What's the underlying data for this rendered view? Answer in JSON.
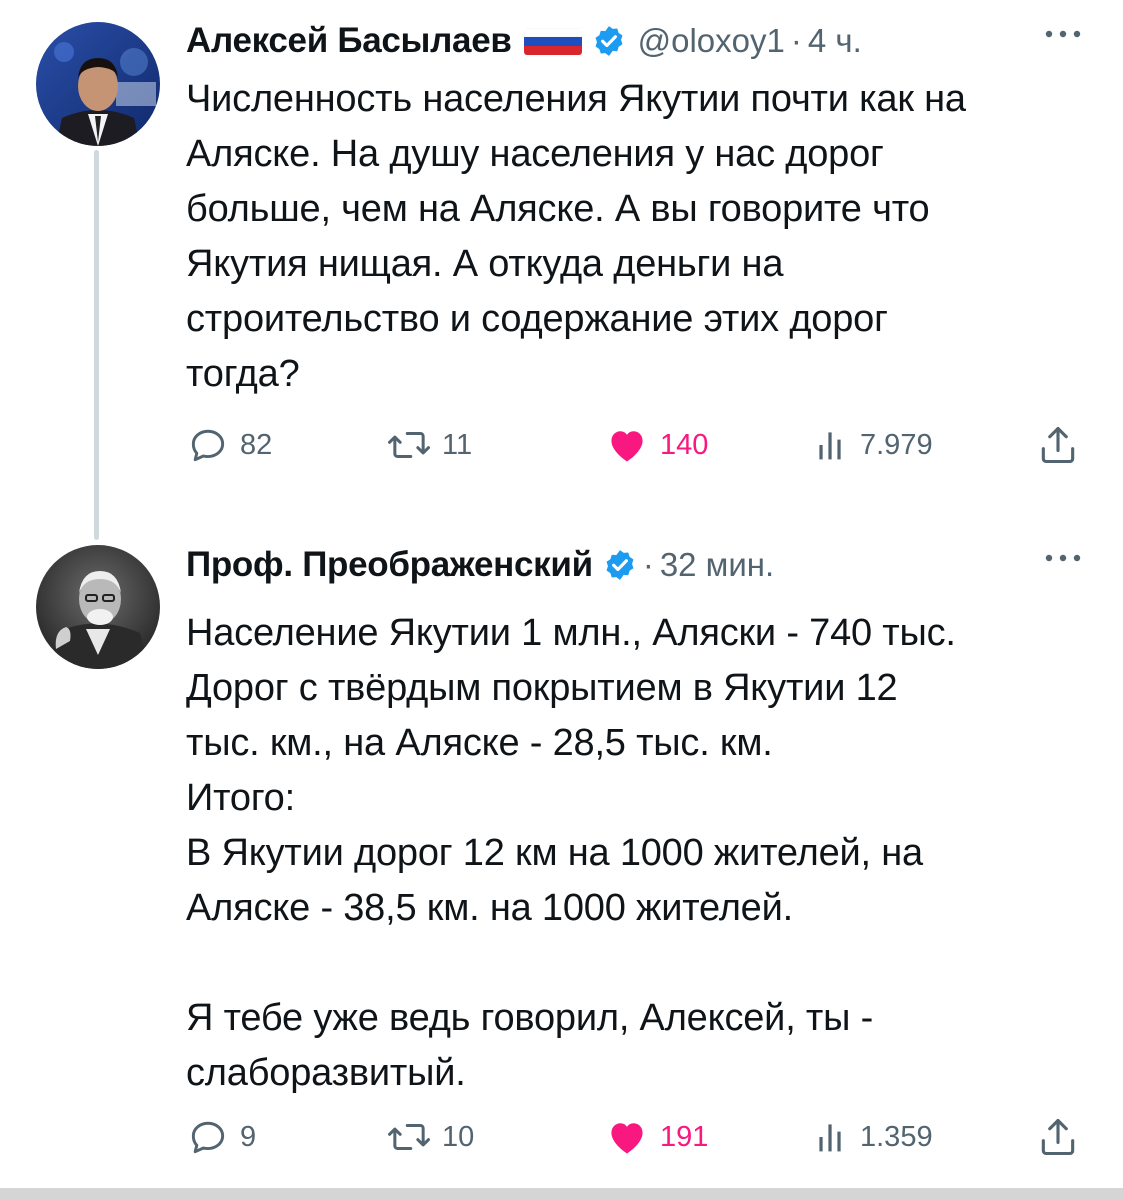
{
  "tweets": [
    {
      "author": {
        "name": "Алексей Басылаев",
        "flag": "russian-flag",
        "verified": true,
        "handle": "@oloxoy1",
        "time": "4 ч."
      },
      "text": "Численность населения Якутии почти как на\nАляске. На душу населения у нас дорог\nбольше, чем на Аляске. А вы говорите что\nЯкутия нищая. А откуда деньги на\nстроительство и содержание этих дорог\nтогда?",
      "stats": {
        "replies": "82",
        "retweets": "11",
        "likes": "140",
        "views": "7.979"
      }
    },
    {
      "author": {
        "name": "Проф. Преображенский",
        "verified": true,
        "time": "32 мин."
      },
      "text": "Население Якутии 1 млн., Аляски - 740 тыс.\nДорог с твёрдым покрытием в Якутии 12\nтыс. км., на Аляске - 28,5 тыс. км.\nИтого:\nВ Якутии дорог 12 км на 1000 жителей, на\nАляске - 38,5 км. на 1000 жителей.\n\nЯ тебе уже ведь говорил, Алексей, ты -\nслаборазвитый.",
      "stats": {
        "replies": "9",
        "retweets": "10",
        "likes": "191",
        "views": "1.359"
      }
    }
  ],
  "colors": {
    "verified": "#1d9bf0",
    "like": "#f91880",
    "muted": "#536471",
    "text": "#0f1419"
  }
}
